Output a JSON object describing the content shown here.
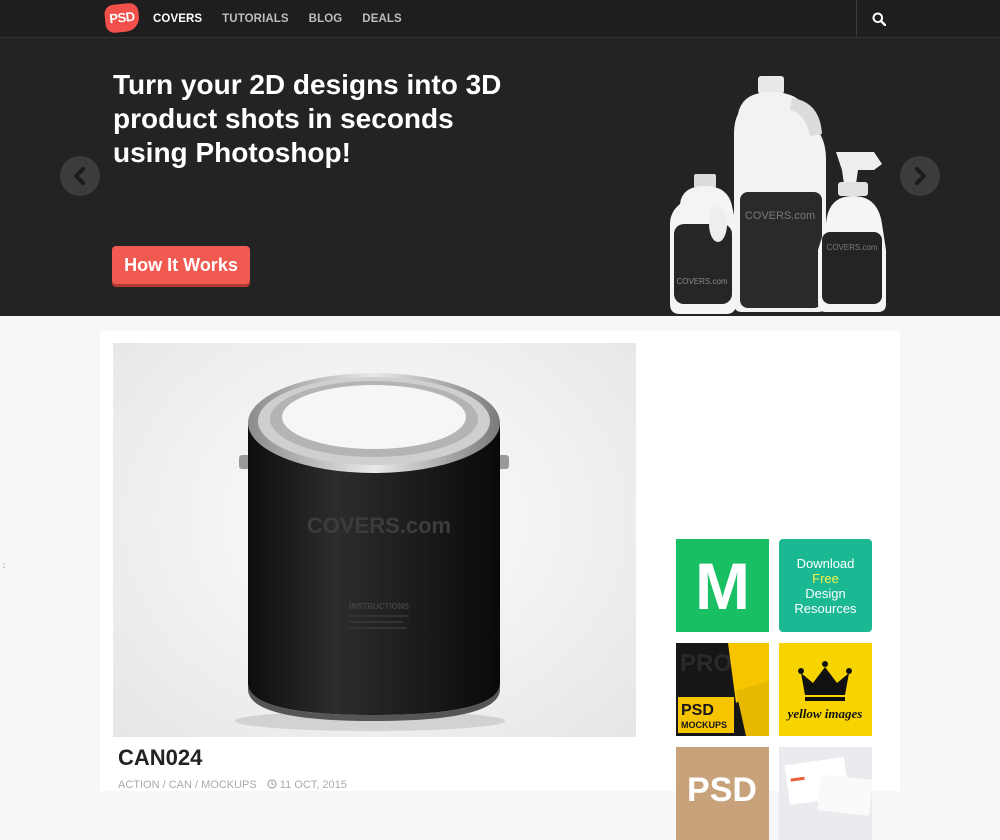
{
  "header": {
    "logo_text": "PSD",
    "nav": [
      {
        "label": "COVERS",
        "active": true
      },
      {
        "label": "TUTORIALS",
        "active": false
      },
      {
        "label": "BLOG",
        "active": false
      },
      {
        "label": "DEALS",
        "active": false
      }
    ],
    "search_icon": "search-icon"
  },
  "hero": {
    "headline": "Turn your 2D designs into 3D product shots in seconds using Photoshop!",
    "cta_label": "How It Works",
    "bottle_brand": "COVERS.com",
    "prev_icon": "chevron-left-icon",
    "next_icon": "chevron-right-icon"
  },
  "post": {
    "image_brand": "COVERS.com",
    "image_label": "INSTRUCTIONS",
    "title": "CAN024",
    "categories": "ACTION / CAN / MOCKUPS",
    "date": "11 OCT, 2015",
    "date_icon": "clock-icon"
  },
  "sidebar_ads": {
    "m_letter": "M",
    "download": {
      "line1": "Download",
      "line2": "Free",
      "line3": "Design",
      "line4": "Resources"
    },
    "psd_mockups": {
      "line1": "PSD",
      "line2": "MOCKUPS"
    },
    "yellow_images": "yellow images",
    "psd_brown": "PSD"
  },
  "colors": {
    "accent_red": "#f05a50",
    "nav_bg": "#1e1e1e",
    "hero_bg": "#232323",
    "m_green": "#18c063",
    "download_teal": "#1bb894",
    "free_yellow": "#f6f047",
    "yellow_images_bg": "#f7d400"
  }
}
